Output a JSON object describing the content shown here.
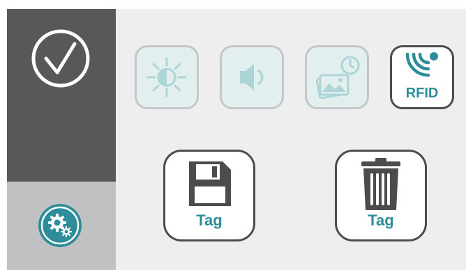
{
  "colors": {
    "sidebar_dark": "#565859",
    "sidebar_light": "#c0c1c3",
    "background": "#eeeeef",
    "accent_teal": "#2d8d9a",
    "disabled_fill": "#e3eeee",
    "disabled_icon": "#a9d4d6",
    "border_dark": "#4a4c4e"
  },
  "sidebar": {
    "confirm": {
      "icon": "checkmark-circle-icon"
    },
    "settings": {
      "icon": "gears-icon"
    }
  },
  "toolbar": {
    "items": [
      {
        "icon": "brightness-icon",
        "enabled": false
      },
      {
        "icon": "volume-icon",
        "enabled": false
      },
      {
        "icon": "gallery-timer-icon",
        "enabled": false
      },
      {
        "icon": "rfid-icon",
        "enabled": true,
        "label": "RFID"
      }
    ]
  },
  "tag_actions": {
    "save": {
      "icon": "floppy-disk-icon",
      "label": "Tag"
    },
    "delete": {
      "icon": "trash-icon",
      "label": "Tag"
    }
  }
}
